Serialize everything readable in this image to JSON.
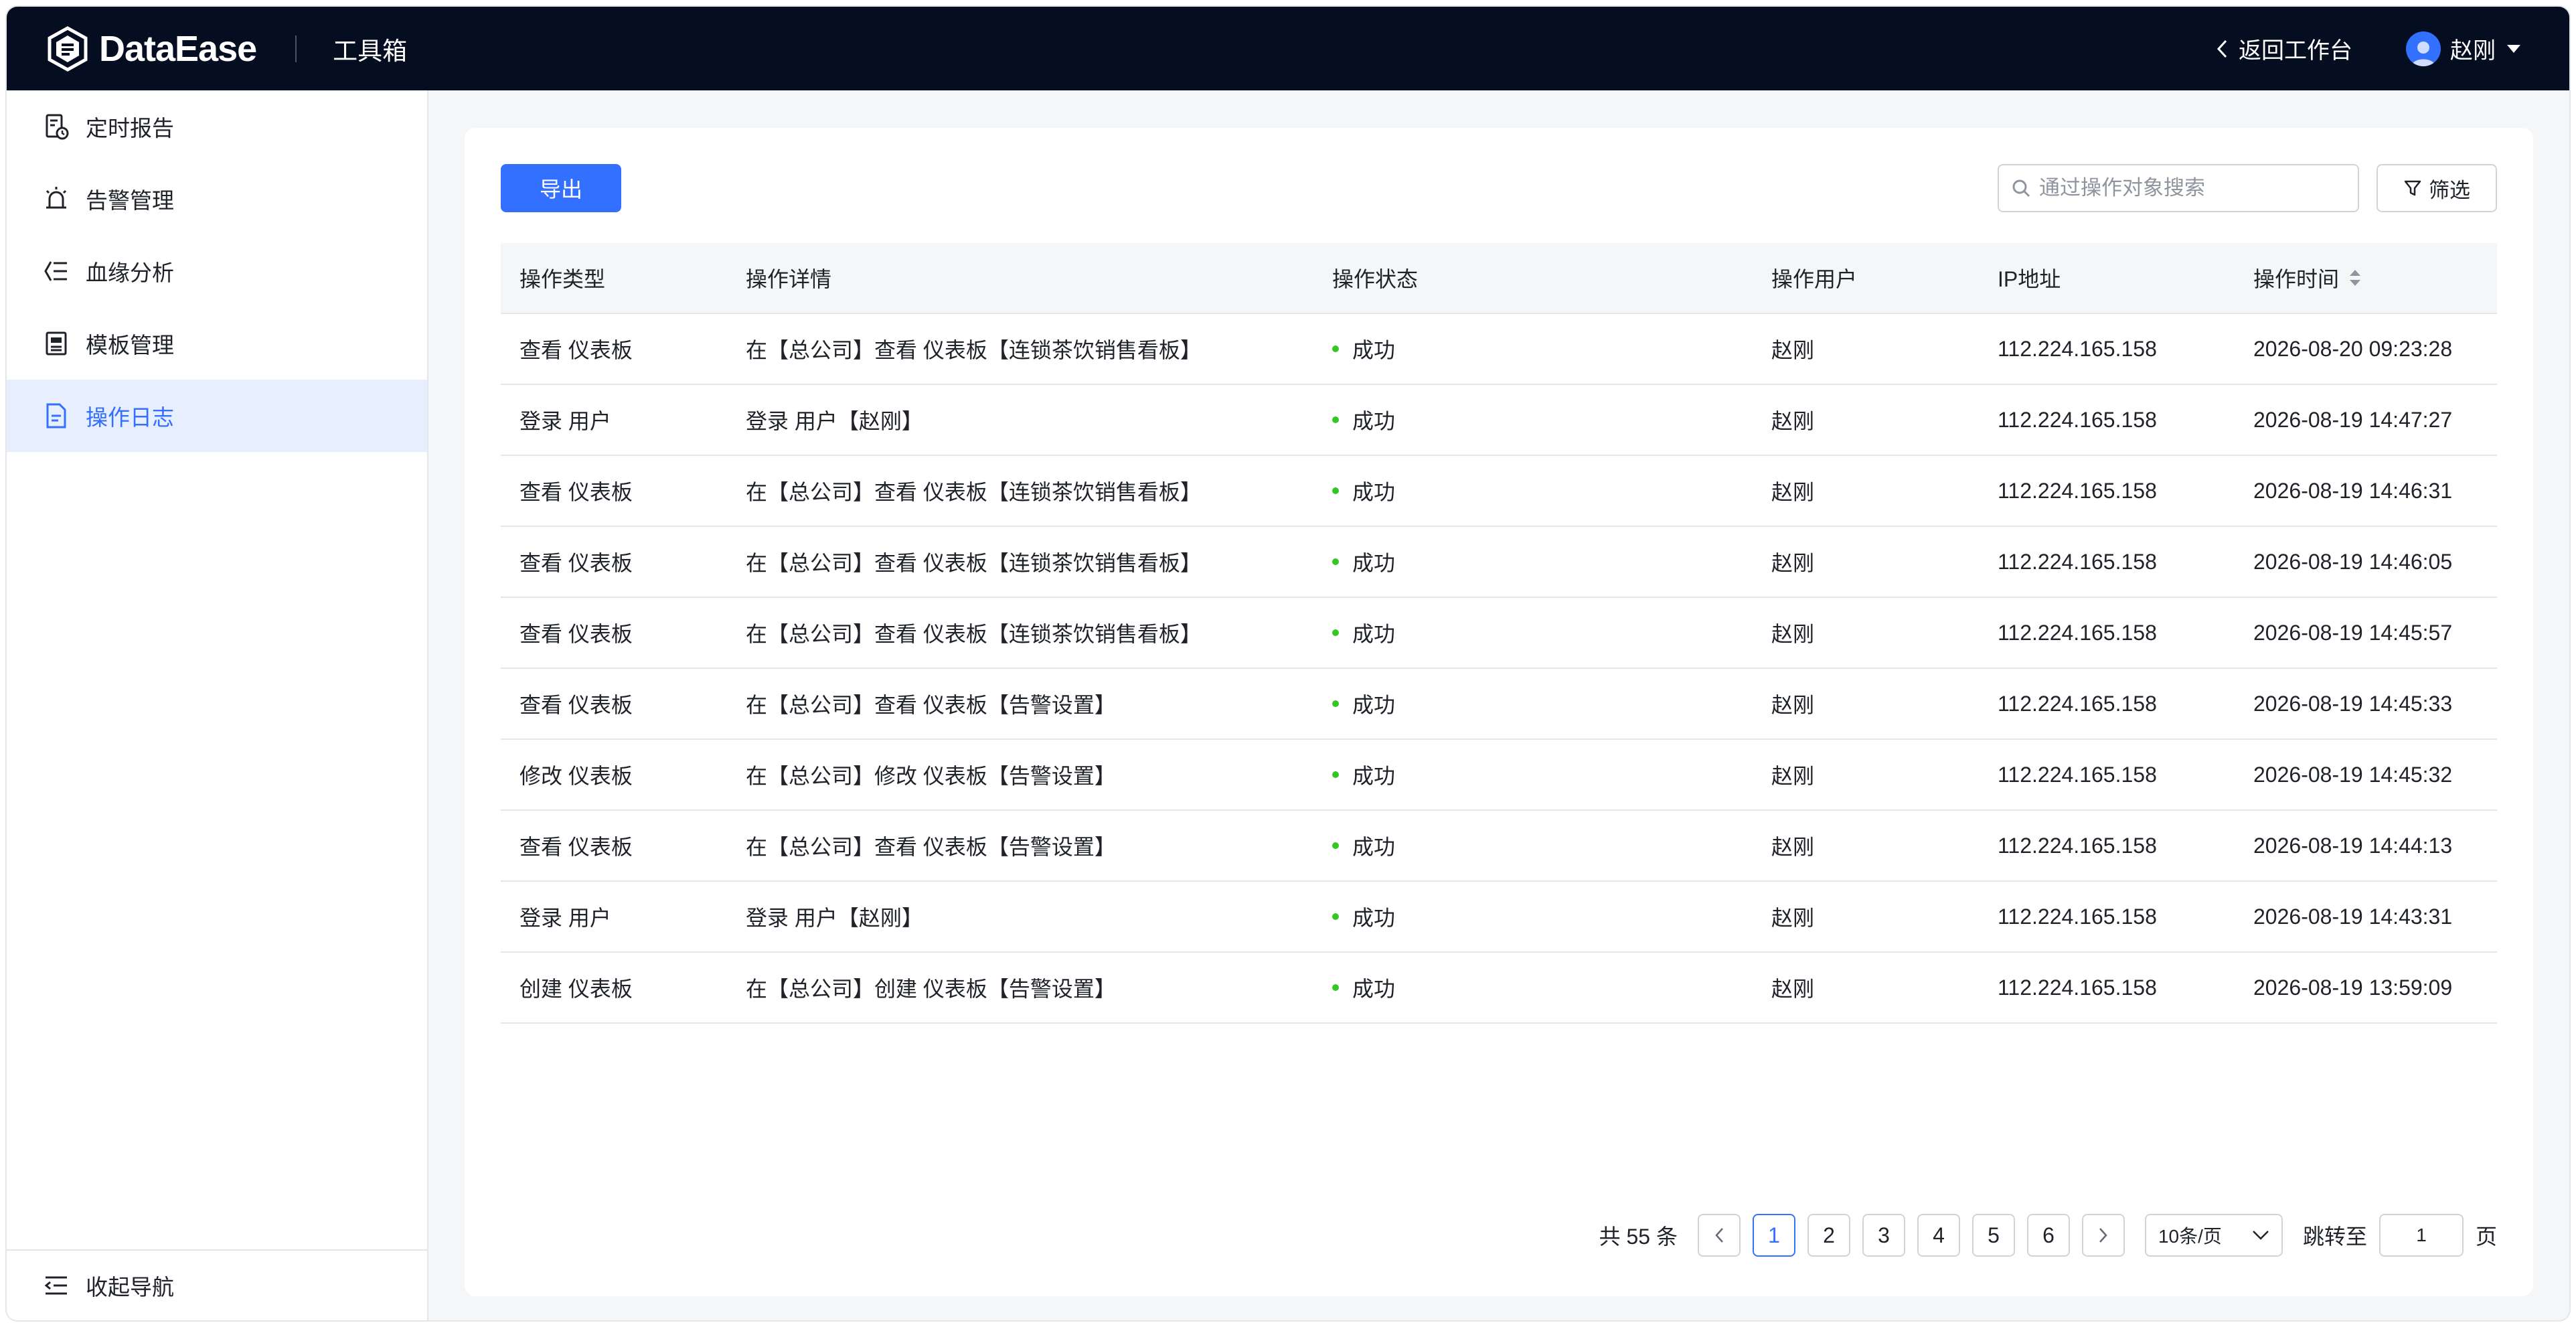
{
  "header": {
    "brand": "DataEase",
    "section_title": "工具箱",
    "back_label": "返回工作台",
    "user_name": "赵刚"
  },
  "sidebar": {
    "items": [
      {
        "label": "定时报告",
        "icon": "scheduled-report-icon",
        "active": false
      },
      {
        "label": "告警管理",
        "icon": "alarm-icon",
        "active": false
      },
      {
        "label": "血缘分析",
        "icon": "lineage-icon",
        "active": false
      },
      {
        "label": "模板管理",
        "icon": "template-icon",
        "active": false
      },
      {
        "label": "操作日志",
        "icon": "log-document-icon",
        "active": true
      }
    ],
    "collapse_label": "收起导航"
  },
  "toolbar": {
    "export_label": "导出",
    "search_placeholder": "通过操作对象搜索",
    "filter_label": "筛选"
  },
  "table": {
    "columns": [
      "操作类型",
      "操作详情",
      "操作状态",
      "操作用户",
      "IP地址",
      "操作时间"
    ],
    "rows": [
      {
        "type": "查看 仪表板",
        "detail": "在【总公司】查看 仪表板【连锁茶饮销售看板】",
        "status": "成功",
        "user": "赵刚",
        "ip": "112.224.165.158",
        "time": "2026-08-20 09:23:28"
      },
      {
        "type": "登录 用户",
        "detail": "登录 用户【赵刚】",
        "status": "成功",
        "user": "赵刚",
        "ip": "112.224.165.158",
        "time": "2026-08-19 14:47:27"
      },
      {
        "type": "查看 仪表板",
        "detail": "在【总公司】查看 仪表板【连锁茶饮销售看板】",
        "status": "成功",
        "user": "赵刚",
        "ip": "112.224.165.158",
        "time": "2026-08-19 14:46:31"
      },
      {
        "type": "查看 仪表板",
        "detail": "在【总公司】查看 仪表板【连锁茶饮销售看板】",
        "status": "成功",
        "user": "赵刚",
        "ip": "112.224.165.158",
        "time": "2026-08-19 14:46:05"
      },
      {
        "type": "查看 仪表板",
        "detail": "在【总公司】查看 仪表板【连锁茶饮销售看板】",
        "status": "成功",
        "user": "赵刚",
        "ip": "112.224.165.158",
        "time": "2026-08-19 14:45:57"
      },
      {
        "type": "查看 仪表板",
        "detail": "在【总公司】查看 仪表板【告警设置】",
        "status": "成功",
        "user": "赵刚",
        "ip": "112.224.165.158",
        "time": "2026-08-19 14:45:33"
      },
      {
        "type": "修改 仪表板",
        "detail": "在【总公司】修改 仪表板【告警设置】",
        "status": "成功",
        "user": "赵刚",
        "ip": "112.224.165.158",
        "time": "2026-08-19 14:45:32"
      },
      {
        "type": "查看 仪表板",
        "detail": "在【总公司】查看 仪表板【告警设置】",
        "status": "成功",
        "user": "赵刚",
        "ip": "112.224.165.158",
        "time": "2026-08-19 14:44:13"
      },
      {
        "type": "登录 用户",
        "detail": "登录 用户【赵刚】",
        "status": "成功",
        "user": "赵刚",
        "ip": "112.224.165.158",
        "time": "2026-08-19 14:43:31"
      },
      {
        "type": "创建 仪表板",
        "detail": "在【总公司】创建 仪表板【告警设置】",
        "status": "成功",
        "user": "赵刚",
        "ip": "112.224.165.158",
        "time": "2026-08-19 13:59:09"
      }
    ]
  },
  "pagination": {
    "total_label": "共 55 条",
    "pages": [
      "1",
      "2",
      "3",
      "4",
      "5",
      "6"
    ],
    "current_page": "1",
    "page_size_label": "10条/页",
    "jump_label": "跳转至",
    "jump_value": "1",
    "jump_unit": "页"
  },
  "colors": {
    "header_bg": "#050e21",
    "accent": "#3370ff",
    "success": "#34c724",
    "active_nav_bg": "#e7eefe"
  }
}
